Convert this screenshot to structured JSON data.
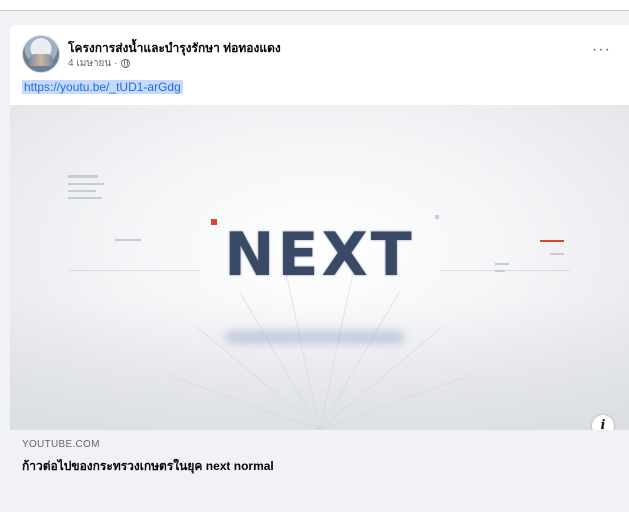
{
  "post": {
    "page_name": "โครงการส่งน้ำและบำรุงรักษา ท่อทองแดง",
    "timestamp": "4 เมษายน ·",
    "more_label": "···",
    "link_text": "https://youtu.be/_tUD1-arGdg",
    "icons": {
      "privacy": "globe-icon",
      "more": "more-options-icon",
      "info": "info-icon"
    }
  },
  "thumbnail": {
    "headline": "NEXT",
    "info_label": "i"
  },
  "preview": {
    "domain": "YOUTUBE.COM",
    "title": "ก้าวต่อไปของกระทรวงเกษตรในยุค next normal"
  }
}
